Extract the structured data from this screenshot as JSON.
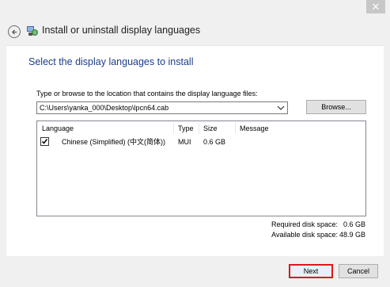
{
  "window": {
    "close_glyph": "✕"
  },
  "header": {
    "title": "Install or uninstall display languages",
    "back_icon": "back-arrow-icon",
    "app_icon": "language-icon"
  },
  "main": {
    "section_title": "Select the display languages to install",
    "path_label": "Type or browse to the location that contains the display language files:",
    "path_value": "C:\\Users\\yanka_000\\Desktop\\lpcn64.cab",
    "browse_label": "Browse..."
  },
  "list": {
    "columns": [
      "Language",
      "Type",
      "Size",
      "Message"
    ],
    "rows": [
      {
        "checked": true,
        "language": "Chinese (Simplified) (中文(简体))",
        "type": "MUI",
        "size": "0.6 GB",
        "message": ""
      }
    ]
  },
  "space": {
    "required_label": "Required disk space:",
    "required_value": "0.6 GB",
    "available_label": "Available disk space:",
    "available_value": "48.9 GB"
  },
  "footer": {
    "next_label": "Next",
    "cancel_label": "Cancel"
  },
  "colors": {
    "accent_blue": "#1c3d8a",
    "highlight_red": "#e0161e",
    "window_bg": "#f0f0f0",
    "content_bg": "#ffffff"
  }
}
